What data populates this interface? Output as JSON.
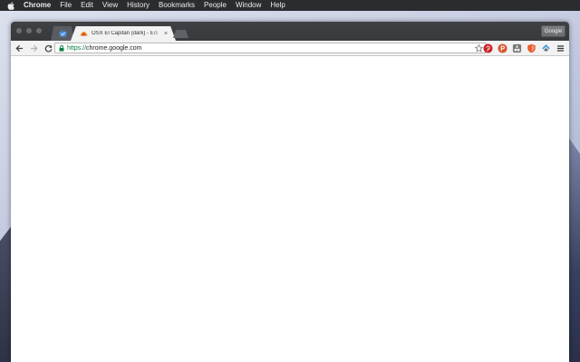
{
  "menubar": {
    "app_name": "Chrome",
    "items": [
      "File",
      "Edit",
      "View",
      "History",
      "Bookmarks",
      "People",
      "Window",
      "Help"
    ]
  },
  "browser": {
    "tabs": [
      {
        "title": "",
        "pinned": true,
        "icon": "chrome-web-store-icon"
      },
      {
        "title": "OSX El Capitan (dark) - Edi",
        "pinned": false,
        "active": true,
        "icon": "extension-favicon"
      }
    ],
    "tab_close_glyph": "×",
    "profile_label": "Google",
    "omnibox": {
      "scheme": "https://",
      "host": "chrome.google.com",
      "secure": true
    },
    "extensions": [
      "pinterest-icon",
      "producthunt-icon",
      "tampermonkey-icon",
      "ublock-icon",
      "feedly-icon",
      "menu-icon"
    ]
  },
  "colors": {
    "menubar_bg": "#2b2c30",
    "titlebar_bg": "#3f4145",
    "toolbar_bg": "#f2f2f2",
    "secure_green": "#0b8043",
    "pinterest": "#cb2027",
    "producthunt": "#da552f"
  }
}
